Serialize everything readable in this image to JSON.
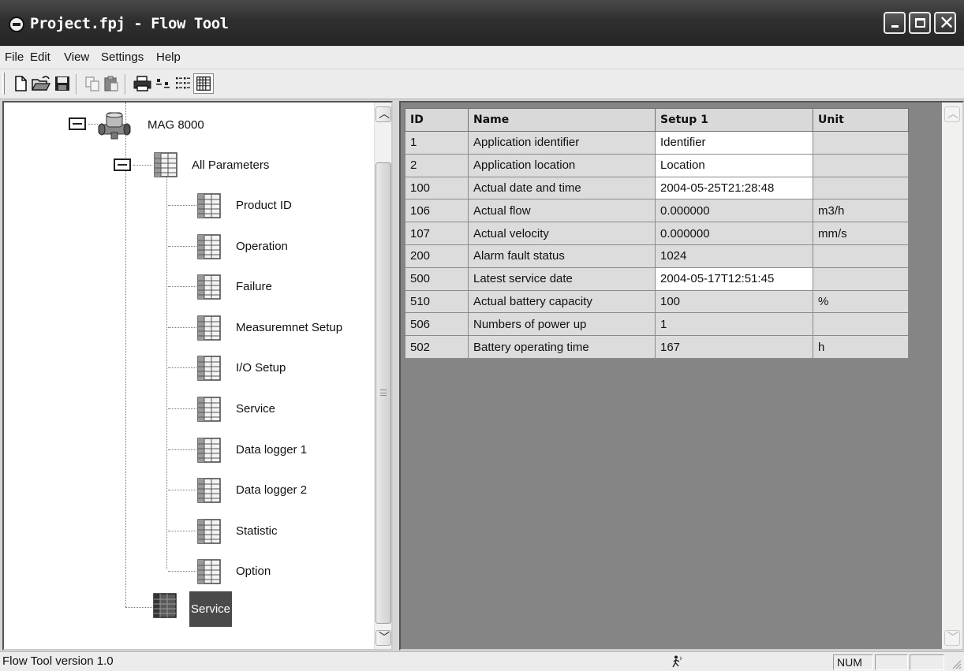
{
  "window": {
    "title": "Project.fpj - Flow Tool"
  },
  "menu": [
    "File",
    "Edit",
    "View",
    "Settings",
    "Help"
  ],
  "toolbar": {
    "icons": [
      "new-file-icon",
      "open-folder-icon",
      "save-icon",
      "copy-icon",
      "paste-icon",
      "print-icon",
      "view-small-icons-icon",
      "view-list-icon",
      "view-details-icon"
    ]
  },
  "tree": {
    "device": "MAG 8000",
    "group": "All Parameters",
    "children": [
      "Product ID",
      "Operation",
      "Failure",
      "Measuremnet Setup",
      "I/O Setup",
      "Service",
      "Data logger 1",
      "Data logger 2",
      "Statistic",
      "Option"
    ],
    "service": "Service"
  },
  "grid": {
    "columns": [
      "ID",
      "Name",
      "Setup 1",
      "Unit"
    ],
    "rows": [
      {
        "id": "1",
        "name": "Application identifier",
        "setup": "Identifier",
        "unit": "",
        "editable": true
      },
      {
        "id": "2",
        "name": "Application location",
        "setup": "Location",
        "unit": "",
        "editable": true
      },
      {
        "id": "100",
        "name": "Actual date and time",
        "setup": "2004-05-25T21:28:48",
        "unit": "",
        "editable": true
      },
      {
        "id": "106",
        "name": "Actual flow",
        "setup": "0.000000",
        "unit": "m3/h",
        "editable": false
      },
      {
        "id": "107",
        "name": "Actual velocity",
        "setup": "0.000000",
        "unit": "mm/s",
        "editable": false
      },
      {
        "id": "200",
        "name": "Alarm fault status",
        "setup": "1024",
        "unit": "",
        "editable": false
      },
      {
        "id": "500",
        "name": "Latest service date",
        "setup": "2004-05-17T12:51:45",
        "unit": "",
        "editable": true
      },
      {
        "id": "510",
        "name": "Actual battery capacity",
        "setup": "100",
        "unit": "%",
        "editable": false
      },
      {
        "id": "506",
        "name": "Numbers of power up",
        "setup": "1",
        "unit": "",
        "editable": false
      },
      {
        "id": "502",
        "name": "Battery operating time",
        "setup": "167",
        "unit": "h",
        "editable": false
      }
    ]
  },
  "status": {
    "text": "Flow Tool version 1.0",
    "num": "NUM"
  }
}
